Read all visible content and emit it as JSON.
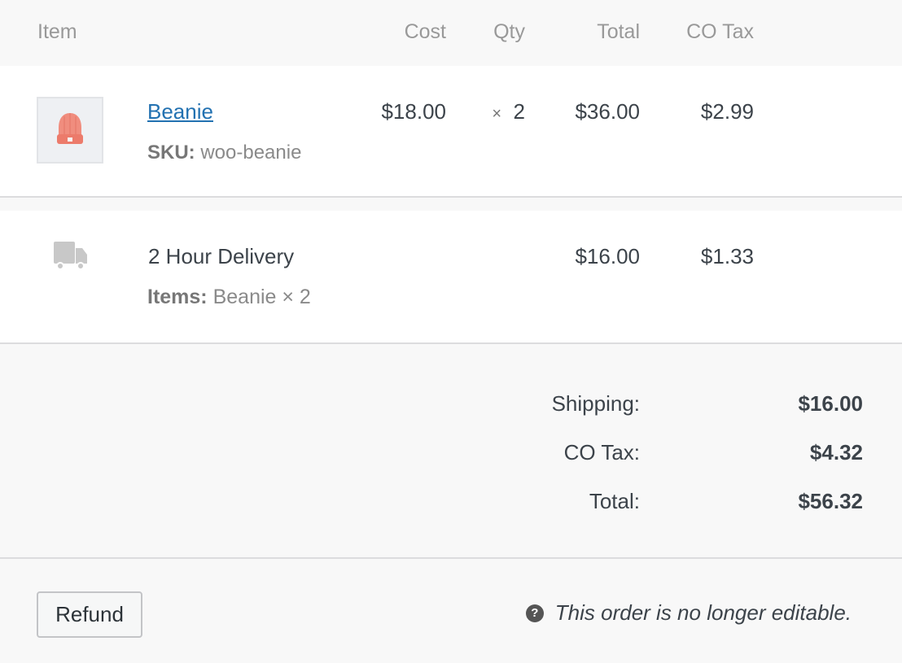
{
  "header": {
    "item": "Item",
    "cost": "Cost",
    "qty": "Qty",
    "total": "Total",
    "tax": "CO Tax"
  },
  "product": {
    "name": "Beanie",
    "sku_label": "SKU:",
    "sku": "woo-beanie",
    "cost": "$18.00",
    "qty_symbol": "×",
    "qty": "2",
    "total": "$36.00",
    "tax": "$2.99",
    "thumbnail_icon": "beanie-thumbnail"
  },
  "shipping_line": {
    "icon": "truck-icon",
    "name": "2 Hour Delivery",
    "items_label": "Items:",
    "items": "Beanie × 2",
    "total": "$16.00",
    "tax": "$1.33"
  },
  "totals": {
    "shipping_label": "Shipping:",
    "shipping": "$16.00",
    "tax_label": "CO Tax:",
    "tax": "$4.32",
    "total_label": "Total:",
    "total": "$56.32"
  },
  "footer": {
    "refund_label": "Refund",
    "note": "This order is no longer editable.",
    "help_glyph": "?"
  },
  "colors": {
    "link": "#2271b1",
    "beanie": "#f08d7e"
  }
}
